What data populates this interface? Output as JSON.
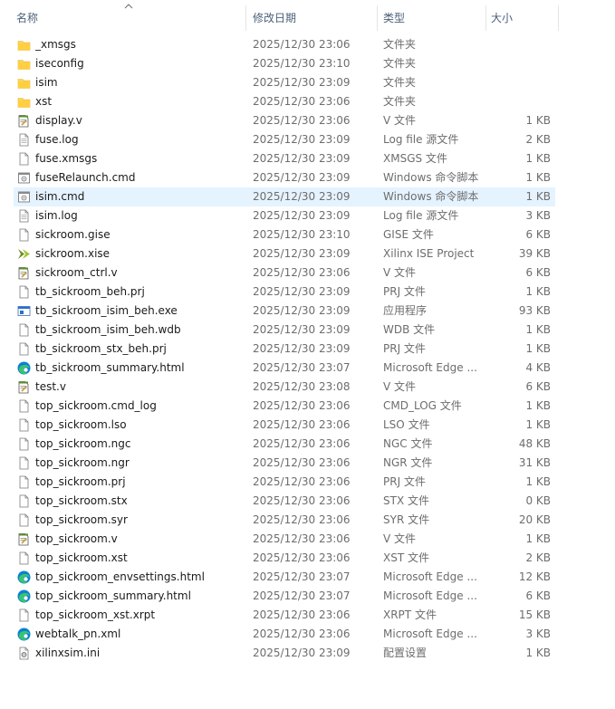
{
  "columns": {
    "name": "名称",
    "date": "修改日期",
    "type": "类型",
    "size": "大小"
  },
  "files": [
    {
      "name": "_xmsgs",
      "date": "2025/12/30 23:06",
      "type": "文件夹",
      "size": "",
      "icon": "folder-icon"
    },
    {
      "name": "iseconfig",
      "date": "2025/12/30 23:10",
      "type": "文件夹",
      "size": "",
      "icon": "folder-icon"
    },
    {
      "name": "isim",
      "date": "2025/12/30 23:09",
      "type": "文件夹",
      "size": "",
      "icon": "folder-icon"
    },
    {
      "name": "xst",
      "date": "2025/12/30 23:06",
      "type": "文件夹",
      "size": "",
      "icon": "folder-icon"
    },
    {
      "name": "display.v",
      "date": "2025/12/30 23:06",
      "type": "V 文件",
      "size": "1 KB",
      "icon": "verilog-file-icon"
    },
    {
      "name": "fuse.log",
      "date": "2025/12/30 23:09",
      "type": "Log file 源文件",
      "size": "2 KB",
      "icon": "text-file-icon"
    },
    {
      "name": "fuse.xmsgs",
      "date": "2025/12/30 23:09",
      "type": "XMSGS 文件",
      "size": "1 KB",
      "icon": "blank-file-icon"
    },
    {
      "name": "fuseRelaunch.cmd",
      "date": "2025/12/30 23:09",
      "type": "Windows 命令脚本",
      "size": "1 KB",
      "icon": "cmd-file-icon"
    },
    {
      "name": "isim.cmd",
      "date": "2025/12/30 23:09",
      "type": "Windows 命令脚本",
      "size": "1 KB",
      "icon": "cmd-file-icon",
      "selected": true
    },
    {
      "name": "isim.log",
      "date": "2025/12/30 23:09",
      "type": "Log file 源文件",
      "size": "3 KB",
      "icon": "text-file-icon"
    },
    {
      "name": "sickroom.gise",
      "date": "2025/12/30 23:10",
      "type": "GISE 文件",
      "size": "6 KB",
      "icon": "blank-file-icon"
    },
    {
      "name": "sickroom.xise",
      "date": "2025/12/30 23:09",
      "type": "Xilinx ISE Project",
      "size": "39 KB",
      "icon": "xilinx-project-icon"
    },
    {
      "name": "sickroom_ctrl.v",
      "date": "2025/12/30 23:06",
      "type": "V 文件",
      "size": "6 KB",
      "icon": "verilog-file-icon"
    },
    {
      "name": "tb_sickroom_beh.prj",
      "date": "2025/12/30 23:09",
      "type": "PRJ 文件",
      "size": "1 KB",
      "icon": "blank-file-icon"
    },
    {
      "name": "tb_sickroom_isim_beh.exe",
      "date": "2025/12/30 23:09",
      "type": "应用程序",
      "size": "93 KB",
      "icon": "exe-file-icon"
    },
    {
      "name": "tb_sickroom_isim_beh.wdb",
      "date": "2025/12/30 23:09",
      "type": "WDB 文件",
      "size": "1 KB",
      "icon": "blank-file-icon"
    },
    {
      "name": "tb_sickroom_stx_beh.prj",
      "date": "2025/12/30 23:09",
      "type": "PRJ 文件",
      "size": "1 KB",
      "icon": "blank-file-icon"
    },
    {
      "name": "tb_sickroom_summary.html",
      "date": "2025/12/30 23:07",
      "type": "Microsoft Edge ...",
      "size": "4 KB",
      "icon": "edge-html-icon"
    },
    {
      "name": "test.v",
      "date": "2025/12/30 23:08",
      "type": "V 文件",
      "size": "6 KB",
      "icon": "verilog-file-icon"
    },
    {
      "name": "top_sickroom.cmd_log",
      "date": "2025/12/30 23:06",
      "type": "CMD_LOG 文件",
      "size": "1 KB",
      "icon": "blank-file-icon"
    },
    {
      "name": "top_sickroom.lso",
      "date": "2025/12/30 23:06",
      "type": "LSO 文件",
      "size": "1 KB",
      "icon": "blank-file-icon"
    },
    {
      "name": "top_sickroom.ngc",
      "date": "2025/12/30 23:06",
      "type": "NGC 文件",
      "size": "48 KB",
      "icon": "blank-file-icon"
    },
    {
      "name": "top_sickroom.ngr",
      "date": "2025/12/30 23:06",
      "type": "NGR 文件",
      "size": "31 KB",
      "icon": "blank-file-icon"
    },
    {
      "name": "top_sickroom.prj",
      "date": "2025/12/30 23:06",
      "type": "PRJ 文件",
      "size": "1 KB",
      "icon": "blank-file-icon"
    },
    {
      "name": "top_sickroom.stx",
      "date": "2025/12/30 23:06",
      "type": "STX 文件",
      "size": "0 KB",
      "icon": "blank-file-icon"
    },
    {
      "name": "top_sickroom.syr",
      "date": "2025/12/30 23:06",
      "type": "SYR 文件",
      "size": "20 KB",
      "icon": "blank-file-icon"
    },
    {
      "name": "top_sickroom.v",
      "date": "2025/12/30 23:06",
      "type": "V 文件",
      "size": "1 KB",
      "icon": "verilog-file-icon"
    },
    {
      "name": "top_sickroom.xst",
      "date": "2025/12/30 23:06",
      "type": "XST 文件",
      "size": "2 KB",
      "icon": "blank-file-icon"
    },
    {
      "name": "top_sickroom_envsettings.html",
      "date": "2025/12/30 23:07",
      "type": "Microsoft Edge ...",
      "size": "12 KB",
      "icon": "edge-html-icon"
    },
    {
      "name": "top_sickroom_summary.html",
      "date": "2025/12/30 23:07",
      "type": "Microsoft Edge ...",
      "size": "6 KB",
      "icon": "edge-html-icon"
    },
    {
      "name": "top_sickroom_xst.xrpt",
      "date": "2025/12/30 23:06",
      "type": "XRPT 文件",
      "size": "15 KB",
      "icon": "blank-file-icon"
    },
    {
      "name": "webtalk_pn.xml",
      "date": "2025/12/30 23:06",
      "type": "Microsoft Edge ...",
      "size": "3 KB",
      "icon": "edge-html-icon"
    },
    {
      "name": "xilinxsim.ini",
      "date": "2025/12/30 23:09",
      "type": "配置设置",
      "size": "1 KB",
      "icon": "settings-file-icon"
    }
  ],
  "colors": {
    "header_text": "#4c607a",
    "selected_row": "#e5f3ff",
    "folder": "#ffd75e",
    "edge_blue": "#0c7fd6",
    "xilinx_green": "#6a8d1b"
  }
}
